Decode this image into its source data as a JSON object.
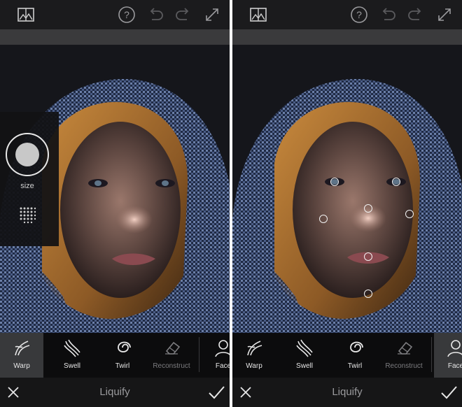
{
  "app": {
    "title": "Liquify"
  },
  "tools": [
    {
      "label": "Warp",
      "icon": "warp-icon"
    },
    {
      "label": "Swell",
      "icon": "swell-icon"
    },
    {
      "label": "Twirl",
      "icon": "twirl-icon"
    },
    {
      "label": "Reconstruct",
      "icon": "eraser-icon"
    },
    {
      "label": "Face",
      "icon": "face-icon"
    }
  ],
  "left_panel": {
    "active_tool": "Warp",
    "size_label": "size"
  },
  "right_panel": {
    "active_tool": "Face"
  },
  "topbar_icons": [
    "image-icon",
    "help-icon",
    "undo-icon",
    "redo-icon",
    "expand-icon"
  ],
  "bottombar_icons": [
    "close-icon",
    "checkmark-icon"
  ],
  "colors": {
    "panel_background": "#0f0f10",
    "active_tool_background": "#38393b",
    "hood_fabric": "#3c4f7a",
    "hair": "#b87a35"
  }
}
